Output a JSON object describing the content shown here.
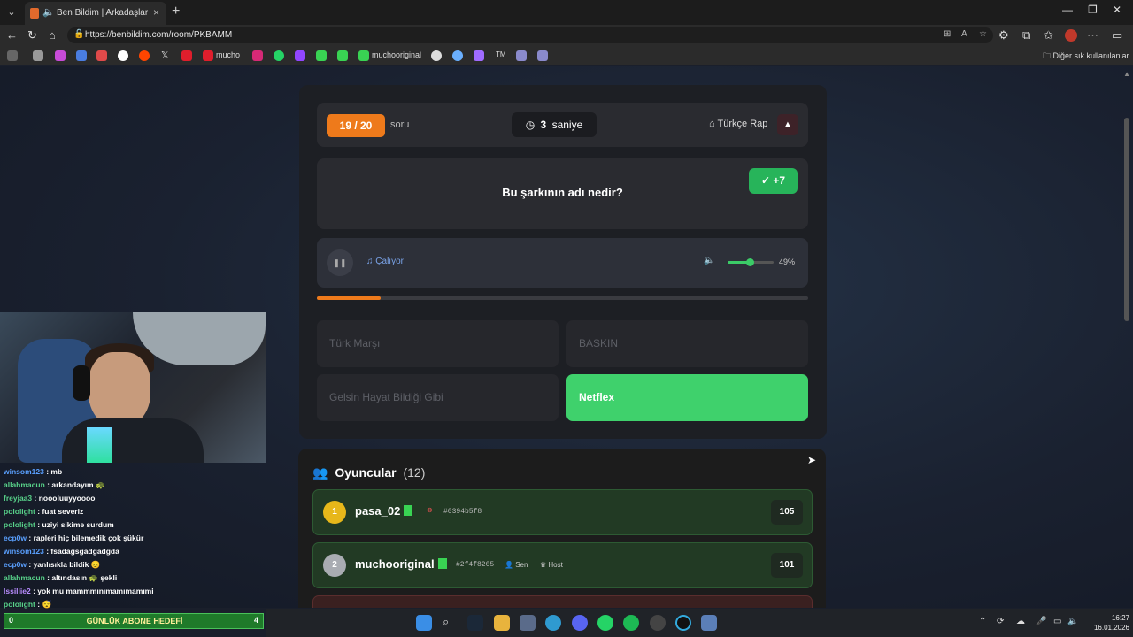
{
  "browser": {
    "tab_title": "Ben Bildim | Arkadaşlarınla Oy",
    "tab_close": "×",
    "new_tab": "+",
    "url": "https://benbildim.com/room/PKBAMM",
    "bookmarks": [
      {
        "label": "mucho",
        "color": "#e01e2c"
      },
      {
        "label": "muchooriginal",
        "color": "#39d353"
      }
    ],
    "bookmark_folder": "Diğer sık kullanılanlar"
  },
  "quiz": {
    "count": "19 / 20",
    "count_label": "soru",
    "timer_value": "3",
    "timer_unit": "saniye",
    "category": "Türkçe Rap",
    "question": "Bu şarkının adı nedir?",
    "score_gain": "+7",
    "player_status": "Çalıyor",
    "volume_pct": "49%",
    "volume_fraction": 0.49,
    "progress_fraction": 0.13,
    "answers": [
      {
        "label": "Türk Marşı",
        "correct": false
      },
      {
        "label": "BASKIN",
        "correct": false
      },
      {
        "label": "Gelsin Hayat Bildiği Gibi",
        "correct": false
      },
      {
        "label": "Netflex",
        "correct": true
      }
    ]
  },
  "players": {
    "title": "Oyuncular",
    "count": "(12)",
    "list": [
      {
        "rank": "1",
        "name": "pasa_02",
        "id": "#0394b5f8",
        "score": "105",
        "badges": []
      },
      {
        "rank": "2",
        "name": "muchooriginal",
        "id": "#2f4f8205",
        "score": "101",
        "badges": [
          "Sen",
          "Host"
        ]
      }
    ]
  },
  "chat": [
    {
      "user": "winsom123",
      "color": "#5aa0ff",
      "msg": "mb"
    },
    {
      "user": "allahmacun",
      "color": "#58d28a",
      "msg": "arkandayım 🐢"
    },
    {
      "user": "freyjaa3",
      "color": "#58d28a",
      "msg": "noooluuyyoooo"
    },
    {
      "user": "pololight",
      "color": "#58d28a",
      "msg": "fuat severiz"
    },
    {
      "user": "pololight",
      "color": "#58d28a",
      "msg": "uziyi sikime surdum"
    },
    {
      "user": "ecp0w",
      "color": "#5aa0ff",
      "msg": "rapleri hiç bilemedik çok şükür"
    },
    {
      "user": "winsom123",
      "color": "#5aa0ff",
      "msg": "fsadagsgadgadgda"
    },
    {
      "user": "ecp0w",
      "color": "#5aa0ff",
      "msg": "yanlısıkla bildik 😞"
    },
    {
      "user": "allahmacun",
      "color": "#58d28a",
      "msg": "altındasın 🐢 şekli"
    },
    {
      "user": "lssillie2",
      "color": "#b88cff",
      "msg": "yok mu mammmınımamımamımi"
    },
    {
      "user": "pololight",
      "color": "#58d28a",
      "msg": "😴"
    }
  ],
  "goal": {
    "left": "0",
    "label": "GÜNLÜK ABONE HEDEFİ",
    "right": "4"
  },
  "clock": {
    "time": "16:27",
    "date": "16.01.2026"
  }
}
